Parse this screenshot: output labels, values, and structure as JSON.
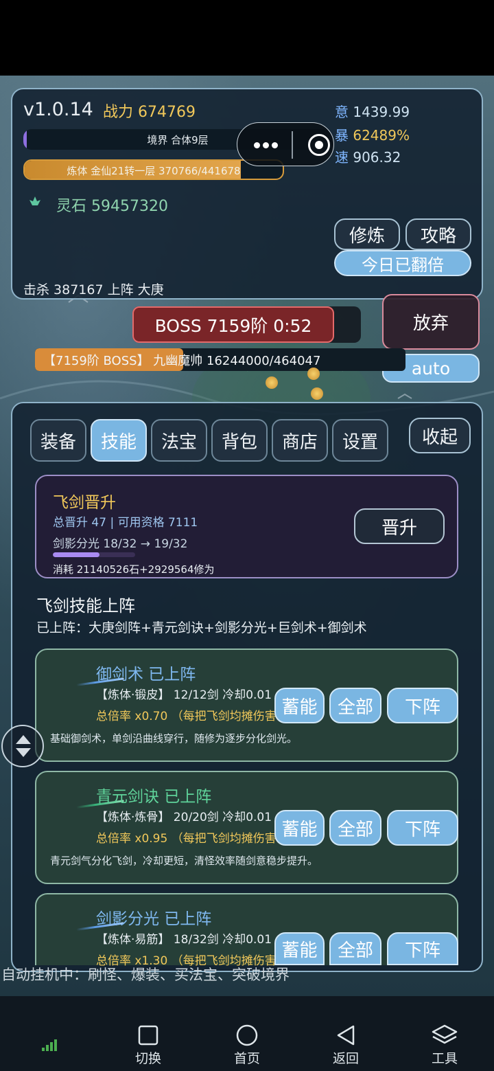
{
  "header": {
    "version": "v1.0.14",
    "power_label": "战力",
    "power_value": "674769",
    "stats": [
      {
        "label": "意",
        "value": "1439.99"
      },
      {
        "label": "暴",
        "value": "62489%"
      },
      {
        "label": "速",
        "value": "906.32"
      }
    ],
    "realm_label": "境界 合体9层",
    "body_label": "炼体 金仙21转一层  370766/441678",
    "body_progress": 0.839,
    "stones_label": "灵石",
    "stones_value": "59457320",
    "kills_text": "击杀 387167  上阵 大庚"
  },
  "buttons": {
    "cultivate": "修炼",
    "guide": "攻略",
    "double": "今日已翻倍",
    "give_up": "放弃",
    "auto": "auto",
    "collapse": "收起"
  },
  "boss": {
    "label": "BOSS 7159阶  0:52",
    "hp_text": "【7159阶 BOSS】 九幽魔帅  16244000/464047",
    "hp_fraction": 0.4
  },
  "tabs": [
    {
      "label": "装备",
      "active": false
    },
    {
      "label": "技能",
      "active": true
    },
    {
      "label": "法宝",
      "active": false
    },
    {
      "label": "背包",
      "active": false
    },
    {
      "label": "商店",
      "active": false
    },
    {
      "label": "设置",
      "active": false
    }
  ],
  "upgrade": {
    "title": "飞剑晋升",
    "line1": "总晋升 47 | 可用资格 7111",
    "line2": "剑影分光  18/32 → 19/32",
    "progress": 0.5625,
    "cost": "消耗 21140526石+2929564修为",
    "button": "晋升"
  },
  "section": {
    "title": "飞剑技能上阵",
    "equipped": "已上阵：大庚剑阵+青元剑诀+剑影分光+巨剑术+御剑术"
  },
  "skills": [
    {
      "name": "御剑术  已上阵",
      "tag": "【炼体·锻皮】 12/12剑  冷却0.01",
      "rate": "总倍率 x0.70  （每把飞剑均摊伤害",
      "desc": "基础御剑术，单剑沿曲线穿行，随修为逐步分化剑光。",
      "color": "blue"
    },
    {
      "name": "青元剑诀  已上阵",
      "tag": "【炼体·炼骨】 20/20剑  冷却0.01",
      "rate": "总倍率 x0.95  （每把飞剑均摊伤害",
      "desc": "青元剑气分化飞剑，冷却更短，清怪效率随剑意稳步提升。",
      "color": "green"
    },
    {
      "name": "剑影分光  已上阵",
      "tag": "【炼体·易筋】 18/32剑  冷却0.01",
      "rate": "总倍率 x1.30  （每把飞剑均摊伤害",
      "desc": "",
      "color": "blue"
    }
  ],
  "skill_buttons": {
    "charge": "蓄能",
    "all": "全部",
    "down": "下阵"
  },
  "auto_status": "自动挂机中：刷怪、爆装、买法宝、突破境界",
  "sysnav": [
    {
      "label": "切换",
      "icon": "square-icon"
    },
    {
      "label": "首页",
      "icon": "circle-icon"
    },
    {
      "label": "返回",
      "icon": "back-triangle-icon"
    },
    {
      "label": "工具",
      "icon": "layers-icon"
    }
  ],
  "colors": {
    "accent": "#7ab6e2",
    "gold": "#f1c85a",
    "boss_red": "#7a2528"
  }
}
